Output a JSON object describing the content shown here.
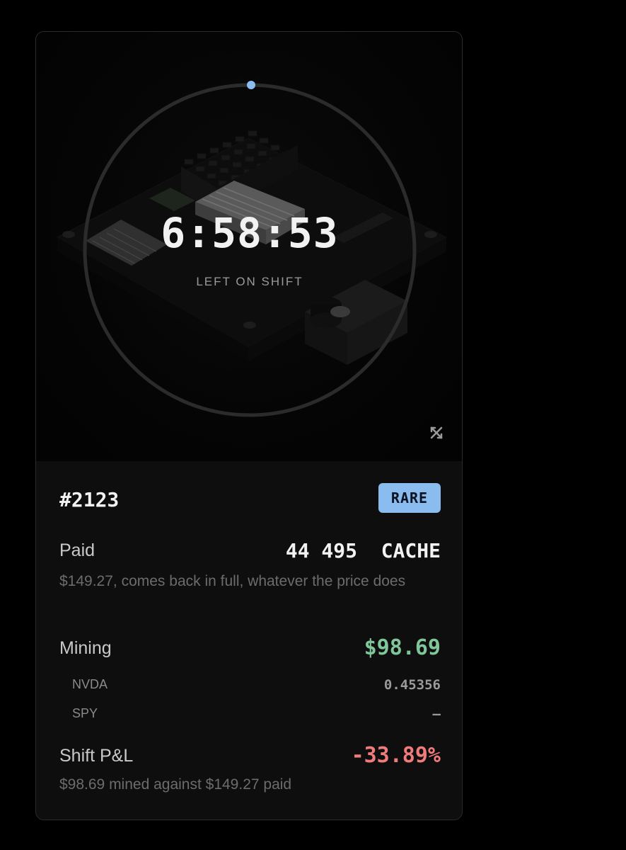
{
  "hero": {
    "timer": "6:58:53",
    "timer_label": "LEFT ON SHIFT",
    "progress_fraction": 0.0,
    "accent_color": "#8bbcf0",
    "expand_icon": "expand-arrows-icon"
  },
  "token": {
    "id": "#2123",
    "rarity": "RARE",
    "rarity_color": "#8bbcf0"
  },
  "paid": {
    "label": "Paid",
    "value": "44 495  CACHE",
    "note": "$149.27, comes back in full, whatever the price does"
  },
  "mining": {
    "label": "Mining",
    "value": "$98.69",
    "value_color": "#7fc79b",
    "holdings": [
      {
        "symbol": "NVDA",
        "amount": "0.45356"
      },
      {
        "symbol": "SPY",
        "amount": "—"
      }
    ]
  },
  "pnl": {
    "label": "Shift P&L",
    "value": "-33.89%",
    "value_color": "#ef7b7b",
    "note": "$98.69 mined against $149.27 paid"
  }
}
